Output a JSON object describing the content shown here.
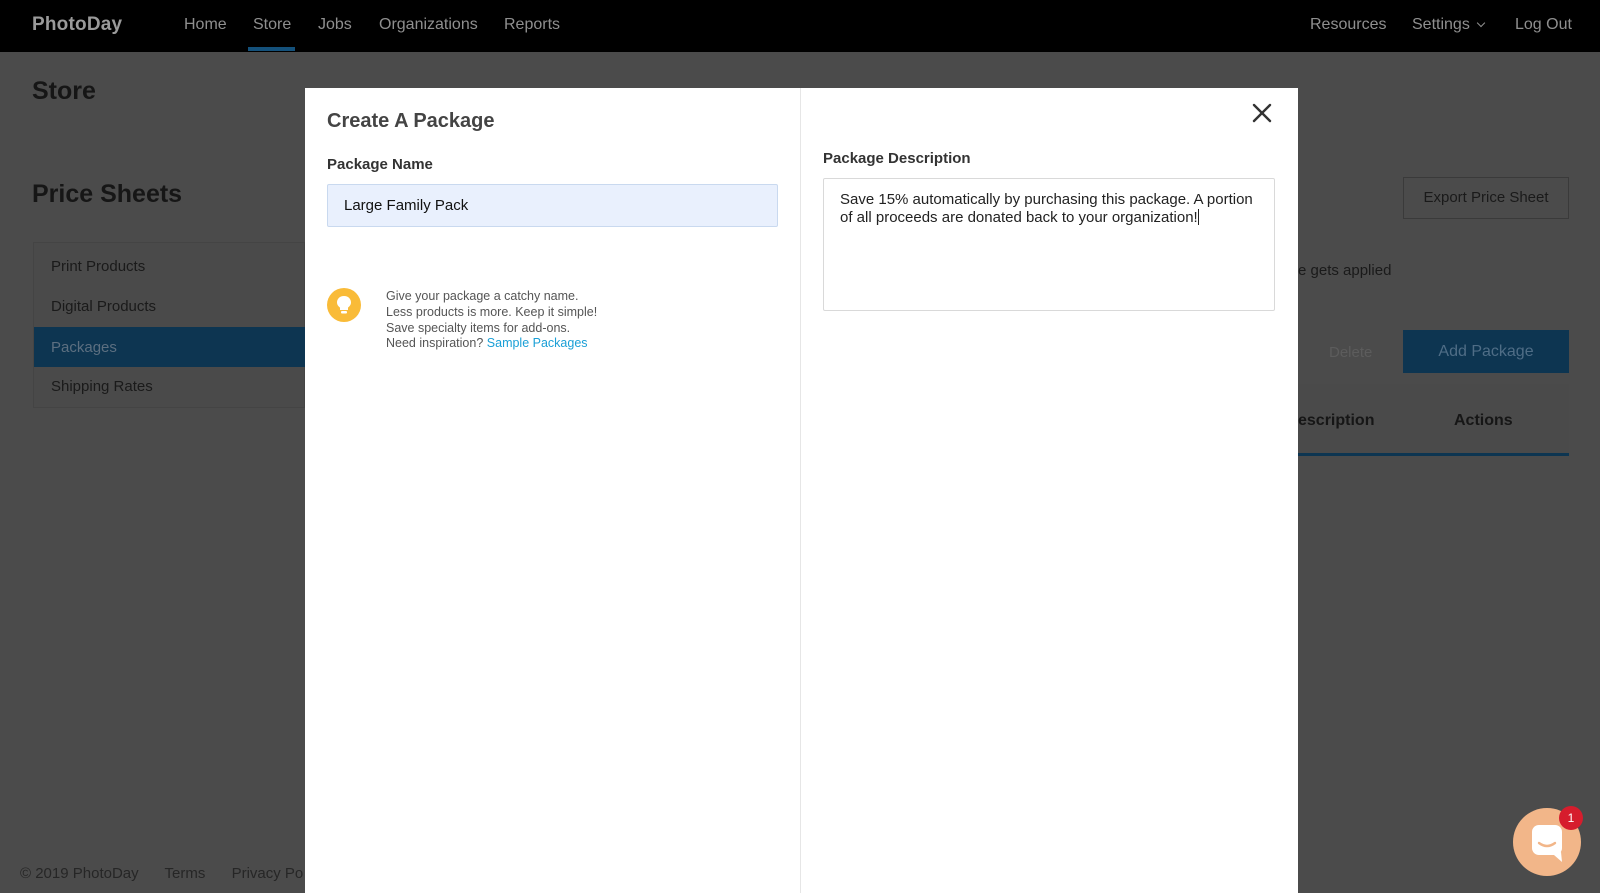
{
  "nav": {
    "logo": "PhotoDay",
    "items": [
      "Home",
      "Store",
      "Jobs",
      "Organizations",
      "Reports"
    ],
    "right": [
      "Resources",
      "Settings",
      "Log Out"
    ]
  },
  "page": {
    "title": "Store",
    "section_title": "Price Sheets",
    "sidebar_items": [
      "Print Products",
      "Digital Products",
      "Packages",
      "Shipping Rates"
    ],
    "export_button": "Export Price Sheet",
    "applied_text": "e gets applied",
    "delete_button": "Delete",
    "add_package_button": "Add Package",
    "table_headers": {
      "description": "escription",
      "actions": "Actions"
    }
  },
  "footer": {
    "copyright": "© 2019 PhotoDay",
    "terms": "Terms",
    "privacy": "Privacy Po"
  },
  "modal": {
    "title": "Create A Package",
    "name_label": "Package Name",
    "name_value": "Large Family Pack",
    "tips": [
      "Give your package a catchy name.",
      "Less products is more. Keep it simple!",
      "Save specialty items for add-ons.",
      "Need inspiration?"
    ],
    "tips_link": "Sample Packages",
    "description_label": "Package Description",
    "description_value": "Save 15% automatically by purchasing this package. A portion of all proceeds are donated back to your organization!"
  },
  "chat": {
    "badge": "1"
  },
  "colors": {
    "accent": "#14517b",
    "link": "#1a9fd6",
    "bulb": "#f9bb38",
    "chat": "#f2b689",
    "badge": "#d61d2d"
  }
}
